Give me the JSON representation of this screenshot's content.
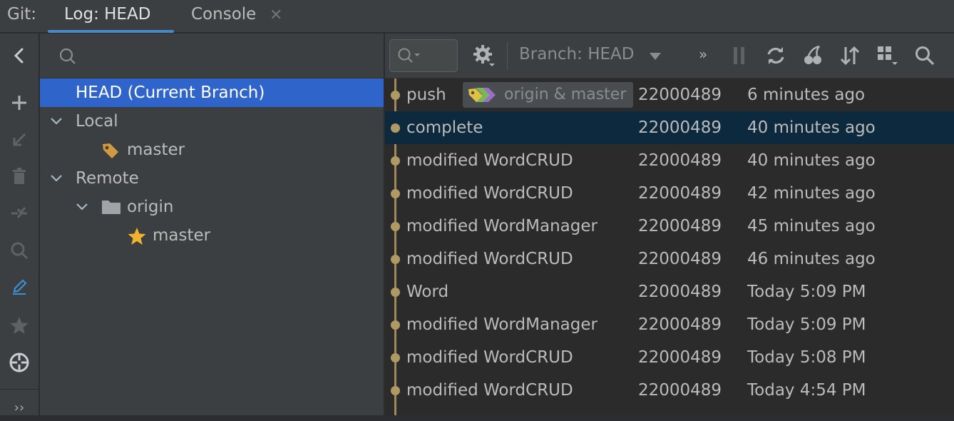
{
  "tabs": {
    "prefix": "Git:",
    "log_label": "Log: HEAD",
    "console_label": "Console",
    "close_glyph": "✕"
  },
  "side_toolbar": {
    "icons": [
      "back-arrow-icon",
      "plus-icon",
      "checkout-arrow-icon",
      "trash-icon",
      "merge-icon",
      "search-icon",
      "edit-icon",
      "star-icon",
      "target-icon",
      "more-icon"
    ],
    "more_glyph": "››"
  },
  "tree": {
    "search_placeholder": "",
    "head": "HEAD (Current Branch)",
    "local_label": "Local",
    "local_master": "master",
    "remote_label": "Remote",
    "origin_label": "origin",
    "origin_master": "master"
  },
  "log_toolbar": {
    "branch_filter": "Branch: HEAD",
    "more_glyph": "»"
  },
  "commits": [
    {
      "msg": "push",
      "author": "22000489",
      "date": "6 minutes ago",
      "ref": "origin & master"
    },
    {
      "msg": "complete",
      "author": "22000489",
      "date": "40 minutes ago"
    },
    {
      "msg": "modified WordCRUD",
      "author": "22000489",
      "date": "40 minutes ago"
    },
    {
      "msg": "modified WordCRUD",
      "author": "22000489",
      "date": "42 minutes ago"
    },
    {
      "msg": "modified WordManager",
      "author": "22000489",
      "date": "45 minutes ago"
    },
    {
      "msg": "modified WordCRUD",
      "author": "22000489",
      "date": "46 minutes ago"
    },
    {
      "msg": "Word",
      "author": "22000489",
      "date": "Today 5:09 PM"
    },
    {
      "msg": "modified WordManager",
      "author": "22000489",
      "date": "Today 5:09 PM"
    },
    {
      "msg": "modified WordCRUD",
      "author": "22000489",
      "date": "Today 5:08 PM"
    },
    {
      "msg": "modified WordCRUD",
      "author": "22000489",
      "date": "Today 4:54 PM"
    }
  ],
  "colors": {
    "accent": "#2f65ca",
    "selected_row": "#0d293e",
    "graph": "#b09a63",
    "tag": "#d19a3e",
    "star": "#f2b230"
  }
}
